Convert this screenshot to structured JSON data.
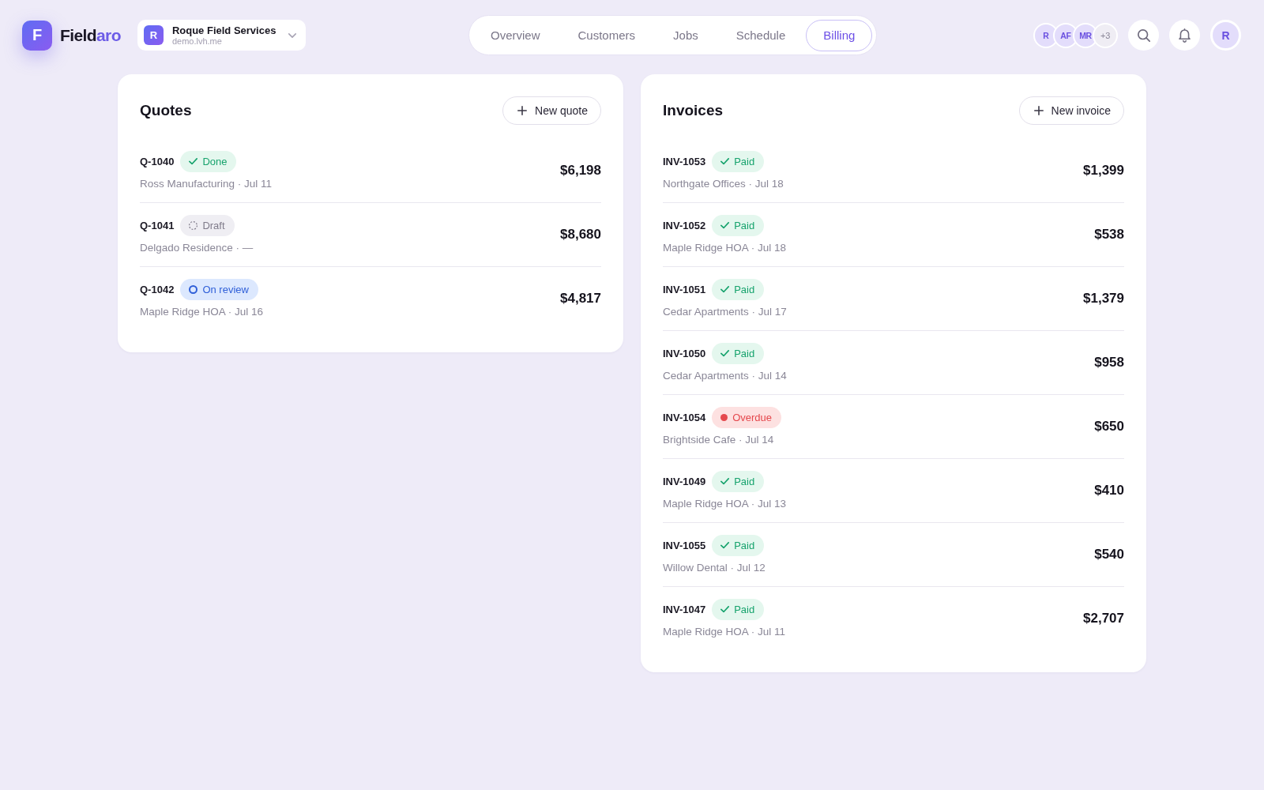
{
  "header": {
    "brand": {
      "initial": "F",
      "parts": [
        {
          "text": "Field",
          "kind": "base"
        },
        {
          "text": "aro",
          "kind": "accent"
        }
      ]
    },
    "workspace": {
      "initial": "R",
      "name": "Roque Field Services",
      "domain": "demo.lvh.me"
    },
    "nav": [
      {
        "label": "Overview",
        "selected": false
      },
      {
        "label": "Customers",
        "selected": false
      },
      {
        "label": "Jobs",
        "selected": false
      },
      {
        "label": "Schedule",
        "selected": false
      },
      {
        "label": "Billing",
        "selected": true
      }
    ],
    "team": [
      {
        "initials": "R",
        "kind": "member"
      },
      {
        "initials": "AF",
        "kind": "member"
      },
      {
        "initials": "MR",
        "kind": "member"
      },
      {
        "initials": "+3",
        "kind": "more"
      }
    ],
    "user": {
      "initials": "R"
    }
  },
  "quotes": {
    "title": "Quotes",
    "action": "New quote",
    "rows": [
      {
        "id": "Q-1040",
        "status": {
          "label": "Done",
          "kind": "done"
        },
        "detail": "Ross Manufacturing · Jul 11",
        "amount": "$6,198"
      },
      {
        "id": "Q-1041",
        "status": {
          "label": "Draft",
          "kind": "draft"
        },
        "detail": "Delgado Residence · —",
        "amount": "$8,680"
      },
      {
        "id": "Q-1042",
        "status": {
          "label": "On review",
          "kind": "review"
        },
        "detail": "Maple Ridge HOA · Jul 16",
        "amount": "$4,817"
      }
    ]
  },
  "invoices": {
    "title": "Invoices",
    "action": "New invoice",
    "rows": [
      {
        "id": "INV-1053",
        "status": {
          "label": "Paid",
          "kind": "paid"
        },
        "detail": "Northgate Offices · Jul 18",
        "amount": "$1,399"
      },
      {
        "id": "INV-1052",
        "status": {
          "label": "Paid",
          "kind": "paid"
        },
        "detail": "Maple Ridge HOA · Jul 18",
        "amount": "$538"
      },
      {
        "id": "INV-1051",
        "status": {
          "label": "Paid",
          "kind": "paid"
        },
        "detail": "Cedar Apartments · Jul 17",
        "amount": "$1,379"
      },
      {
        "id": "INV-1050",
        "status": {
          "label": "Paid",
          "kind": "paid"
        },
        "detail": "Cedar Apartments · Jul 14",
        "amount": "$958"
      },
      {
        "id": "INV-1054",
        "status": {
          "label": "Overdue",
          "kind": "overdue"
        },
        "detail": "Brightside Cafe · Jul 14",
        "amount": "$650"
      },
      {
        "id": "INV-1049",
        "status": {
          "label": "Paid",
          "kind": "paid"
        },
        "detail": "Maple Ridge HOA · Jul 13",
        "amount": "$410"
      },
      {
        "id": "INV-1055",
        "status": {
          "label": "Paid",
          "kind": "paid"
        },
        "detail": "Willow Dental · Jul 12",
        "amount": "$540"
      },
      {
        "id": "INV-1047",
        "status": {
          "label": "Paid",
          "kind": "paid"
        },
        "detail": "Maple Ridge HOA · Jul 11",
        "amount": "$2,707"
      }
    ]
  }
}
